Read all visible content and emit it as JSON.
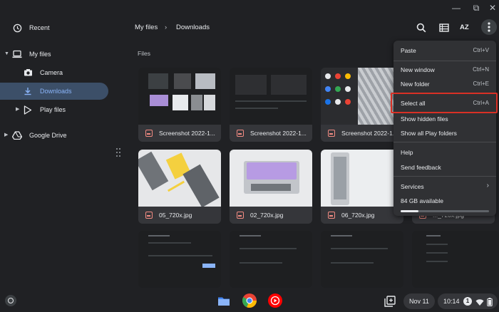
{
  "window": {
    "minimize_glyph": "—",
    "maximize_glyph": "⧉",
    "close_glyph": "✕"
  },
  "sidebar": {
    "recent": "Recent",
    "my_files": "My files",
    "camera": "Camera",
    "downloads": "Downloads",
    "play_files": "Play files",
    "google_drive": "Google Drive"
  },
  "breadcrumb": {
    "root": "My files",
    "separator": "›",
    "current": "Downloads"
  },
  "toolbar": {
    "sort_label": "AZ"
  },
  "section": {
    "files_label": "Files"
  },
  "files": [
    {
      "name": "Screenshot 2022-1..."
    },
    {
      "name": "Screenshot 2022-1..."
    },
    {
      "name": "Screenshot 2022-1..."
    },
    {
      "name": "05_720x.jpg"
    },
    {
      "name": "02_720x.jpg"
    },
    {
      "name": "06_720x.jpg"
    },
    {
      "name": "..._720x.jpg"
    }
  ],
  "menu": {
    "items": [
      {
        "label": "Paste",
        "shortcut": "Ctrl+V"
      },
      {
        "label": "New window",
        "shortcut": "Ctrl+N"
      },
      {
        "label": "New folder",
        "shortcut": "Ctrl+E"
      },
      {
        "label": "Select all",
        "shortcut": "Ctrl+A"
      },
      {
        "label": "Show hidden files",
        "shortcut": ""
      },
      {
        "label": "Show all Play folders",
        "shortcut": ""
      },
      {
        "label": "Help",
        "shortcut": ""
      },
      {
        "label": "Send feedback",
        "shortcut": ""
      },
      {
        "label": "Services",
        "shortcut": "›"
      }
    ],
    "storage": "84 GB available",
    "storage_used_fraction": 0.2
  },
  "shelf": {
    "date": "Nov 11",
    "time": "10:14",
    "notification_count": "1"
  },
  "colors": {
    "accent": "#8ab4f8",
    "highlight": "#d93025",
    "selected_bg": "#3c4f68"
  }
}
